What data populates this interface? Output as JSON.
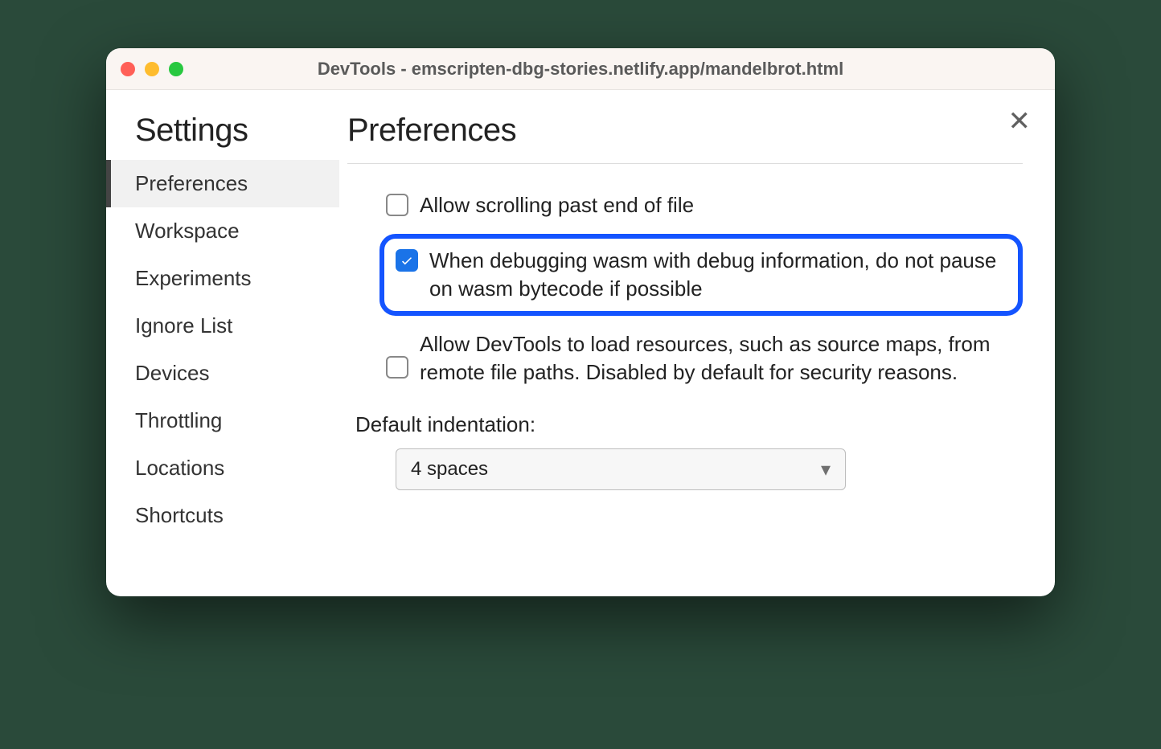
{
  "window": {
    "title": "DevTools - emscripten-dbg-stories.netlify.app/mandelbrot.html"
  },
  "sidebar": {
    "title": "Settings",
    "items": [
      {
        "label": "Preferences",
        "active": true
      },
      {
        "label": "Workspace"
      },
      {
        "label": "Experiments"
      },
      {
        "label": "Ignore List"
      },
      {
        "label": "Devices"
      },
      {
        "label": "Throttling"
      },
      {
        "label": "Locations"
      },
      {
        "label": "Shortcuts"
      }
    ]
  },
  "main": {
    "title": "Preferences",
    "options": [
      {
        "label": "Allow scrolling past end of file",
        "checked": false,
        "highlight": false
      },
      {
        "label": "When debugging wasm with debug information, do not pause on wasm bytecode if possible",
        "checked": true,
        "highlight": true
      },
      {
        "label": "Allow DevTools to load resources, such as source maps, from remote file paths. Disabled by default for security reasons.",
        "checked": false,
        "highlight": false
      }
    ],
    "indent": {
      "label": "Default indentation:",
      "value": "4 spaces"
    }
  }
}
